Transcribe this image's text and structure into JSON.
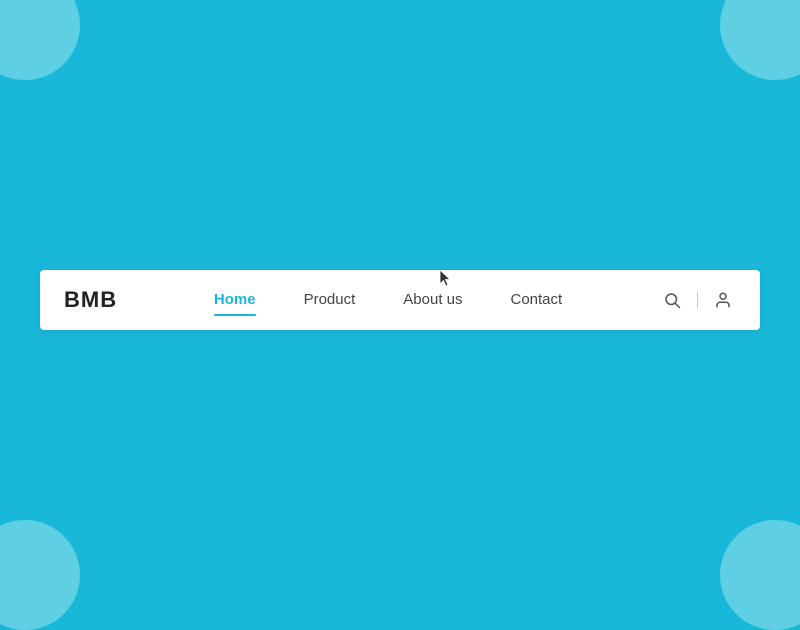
{
  "background": {
    "color": "#1ab8d8",
    "corner_color": "#7ed8ea"
  },
  "navbar": {
    "brand": "BMB",
    "nav_items": [
      {
        "label": "Home",
        "active": true
      },
      {
        "label": "Product",
        "active": false
      },
      {
        "label": "About us",
        "active": false
      },
      {
        "label": "Contact",
        "active": false
      }
    ],
    "icons": {
      "search_label": "search",
      "user_label": "user"
    }
  }
}
